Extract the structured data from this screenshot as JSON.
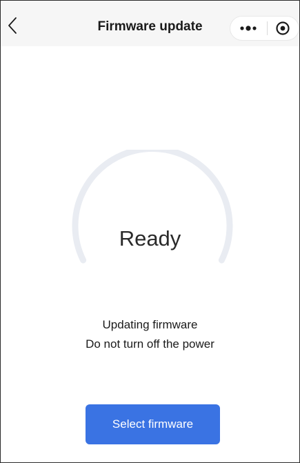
{
  "header": {
    "title": "Firmware update",
    "back_icon": "chevron-left-icon",
    "menu_icon": "more-dots-icon",
    "close_icon": "record-target-icon"
  },
  "gauge": {
    "status": "Ready",
    "progress": 0,
    "track_color": "#e9ecf2"
  },
  "message": {
    "line1": "Updating firmware",
    "line2": "Do not turn off the power"
  },
  "actions": {
    "select_label": "Select firmware",
    "accent_color": "#3a73e3"
  }
}
